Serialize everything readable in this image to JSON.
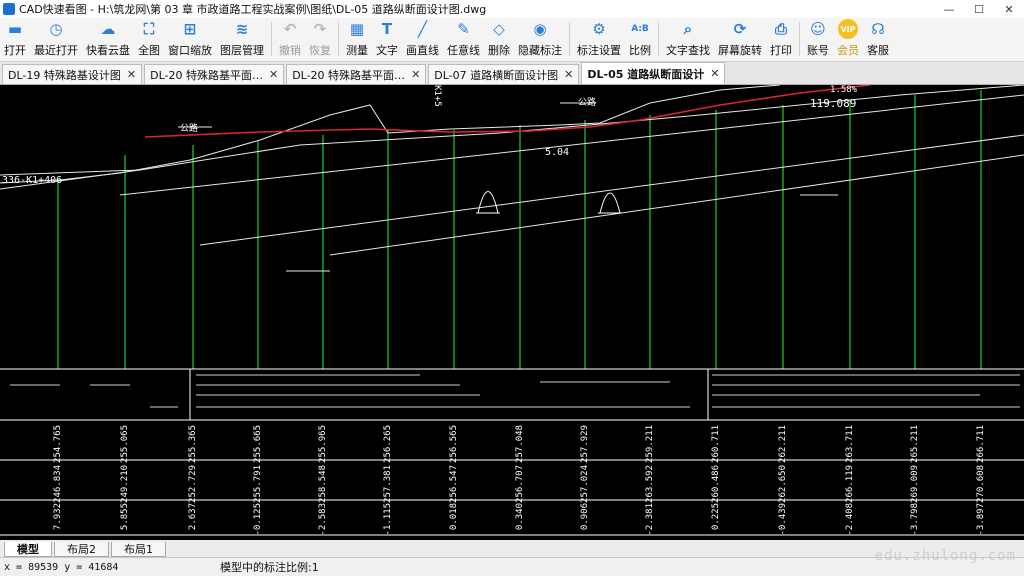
{
  "window": {
    "title": "CAD快速看图 - H:\\筑龙网\\第 03 章 市政道路工程实战案例\\图纸\\DL-05 道路纵断面设计图.dwg",
    "minimize": "—",
    "maximize": "☐",
    "close": "✕"
  },
  "toolbar": {
    "items": [
      {
        "label": "打开",
        "icon": "folder-icon"
      },
      {
        "label": "最近打开",
        "icon": "clock-icon"
      },
      {
        "label": "快看云盘",
        "icon": "cloud-icon"
      },
      {
        "label": "全图",
        "icon": "fullview-icon"
      },
      {
        "label": "窗口缩放",
        "icon": "window-zoom-icon"
      },
      {
        "label": "图层管理",
        "icon": "layers-icon"
      },
      {
        "label": "撤销",
        "icon": "undo-icon",
        "disabled": true
      },
      {
        "label": "恢复",
        "icon": "redo-icon",
        "disabled": true
      },
      {
        "label": "测量",
        "icon": "ruler-icon"
      },
      {
        "label": "文字",
        "icon": "text-icon"
      },
      {
        "label": "画直线",
        "icon": "line-icon"
      },
      {
        "label": "任意线",
        "icon": "polyline-icon"
      },
      {
        "label": "删除",
        "icon": "eraser-icon"
      },
      {
        "label": "隐藏标注",
        "icon": "eye-icon"
      },
      {
        "label": "标注设置",
        "icon": "annotation-settings-icon"
      },
      {
        "label": "比例",
        "icon": "scale-icon"
      },
      {
        "label": "文字查找",
        "icon": "text-search-icon"
      },
      {
        "label": "屏幕旋转",
        "icon": "rotate-icon"
      },
      {
        "label": "打印",
        "icon": "printer-icon"
      },
      {
        "label": "账号",
        "icon": "user-icon"
      },
      {
        "label": "会员",
        "icon": "vip-icon"
      },
      {
        "label": "客服",
        "icon": "headset-icon"
      }
    ],
    "vip_badge": "VIP",
    "scale_glyph": "A:B"
  },
  "doc_tabs": [
    {
      "label": "DL-19 特殊路基设计图",
      "close": "✕"
    },
    {
      "label": "DL-20 特殊路基平面…",
      "close": "✕"
    },
    {
      "label": "DL-20 特殊路基平面…",
      "close": "✕"
    },
    {
      "label": "DL-07 道路横断面设计图",
      "close": "✕"
    },
    {
      "label": "DL-05 道路纵断面设计",
      "close": "✕",
      "active": true
    }
  ],
  "drawing": {
    "labels": {
      "station_left": "336-K1+406",
      "elev_1": "119.089",
      "slope_label": "5.04",
      "station_top": "K1+5",
      "grade_top": "1.58%",
      "road_1": "公路",
      "road_2": "公路"
    },
    "table": {
      "row1": [
        "254.765",
        "255.065",
        "255.365",
        "255.665",
        "255.965",
        "256.265",
        "256.565",
        "257.048",
        "257.929",
        "259.211",
        "260.711",
        "262.211",
        "263.711",
        "265.211",
        "266.711"
      ],
      "row2": [
        "246.834",
        "249.210",
        "252.729",
        "255.791",
        "258.548",
        "257.381",
        "256.547",
        "256.707",
        "257.024",
        "263.592",
        "260.486",
        "262.650",
        "266.119",
        "269.009",
        "270.608"
      ],
      "row3": [
        "7.932",
        "5.855",
        "2.637",
        "-0.125",
        "-2.583",
        "-1.115",
        "0.018",
        "0.340",
        "0.906",
        "-2.381",
        "0.225",
        "-0.439",
        "-2.408",
        "-3.798",
        "-3.897"
      ]
    }
  },
  "layout_tabs": [
    {
      "label": "模型",
      "active": true
    },
    {
      "label": "布局2"
    },
    {
      "label": "布局1"
    }
  ],
  "status": {
    "coords": "x = 89539  y = 41684",
    "scale_text": "模型中的标注比例:1"
  },
  "watermark": "edu.zhulong.com"
}
